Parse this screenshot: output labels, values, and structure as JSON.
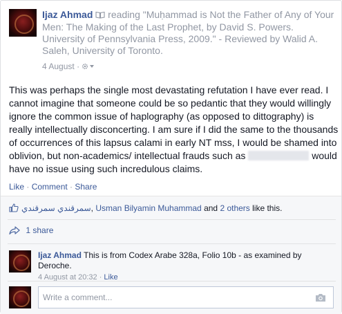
{
  "post": {
    "author": "Ijaz Ahmad",
    "activity": "reading \"Muḥammad is Not the Father of Any of Your Men: The Making of the Last Prophet, by David S. Powers. University of Pennsylvania Press, 2009.\" - Reviewed by Walid A. Saleh, University of Toronto.",
    "date": "4 August",
    "separator": "·",
    "body_part1": "This was perhaps the single most devastating refutation I have ever read. I cannot imagine that someone could be so pedantic that they would willingly ignore the common issue of haplography (as opposed to dittography) is really intellectually disconcerting. I am sure if I did the same to the thousands of occurrences of this lapsus calami in early NT mss, I would be shamed into oblivion, but non-academics/ intellectual frauds such as",
    "body_part2": "would have no issue using such incredulous claims.",
    "actions": {
      "like": "Like",
      "comment": "Comment",
      "share": "Share",
      "dot": " · "
    }
  },
  "feedback": {
    "likers_link": "سمرقندي سمرقندي",
    "likers_sep": ", ",
    "liker2": "Usman Bilyamin Muhammad",
    "and_text": " and ",
    "others_link": "2 others",
    "like_suffix": " like this.",
    "shares": "1 share"
  },
  "comment": {
    "author": "Ijaz Ahmad",
    "text": "This is from Codex Arabe 328a, Folio 10b - as examined by Deroche.",
    "time": "4 August at 20:32",
    "sep": " · ",
    "like": "Like"
  },
  "composer": {
    "placeholder": "Write a comment..."
  },
  "colors": {
    "link": "#3b5998",
    "meta": "#9197a3",
    "feedback_bg": "#f6f7f9"
  }
}
